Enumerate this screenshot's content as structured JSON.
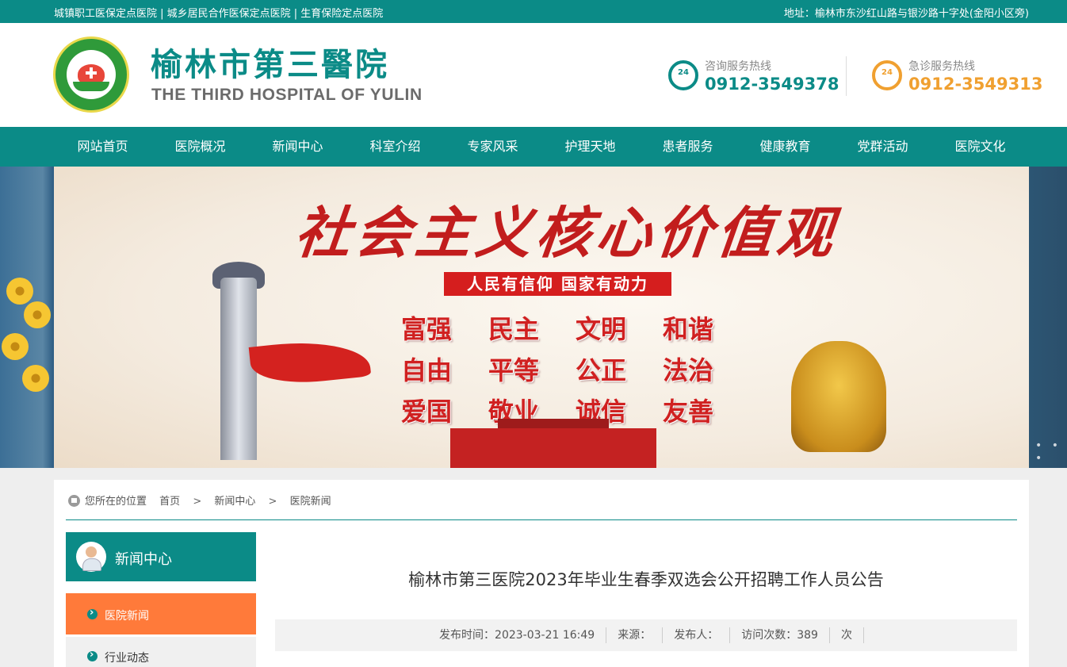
{
  "topbar": {
    "left": "城镇职工医保定点医院 | 城乡居民合作医保定点医院 | 生育保险定点医院",
    "right": "地址：榆林市东沙红山路与银沙路十字处(金阳小区旁)"
  },
  "header": {
    "cn_name": "榆林市第三醫院",
    "en_name": "THE THIRD HOSPITAL OF YULIN",
    "hotline_consult": {
      "label": "咨询服务热线",
      "number": "0912-3549378",
      "badge": "24"
    },
    "hotline_emergency": {
      "label": "急诊服务热线",
      "number": "0912-3549313",
      "badge": "24"
    }
  },
  "nav": {
    "items": [
      "网站首页",
      "医院概况",
      "新闻中心",
      "科室介绍",
      "专家风采",
      "护理天地",
      "患者服务",
      "健康教育",
      "党群活动",
      "医院文化"
    ]
  },
  "banner": {
    "title": "社会主义核心价值观",
    "slogan": "人民有信仰  国家有动力",
    "values": [
      "富强",
      "民主",
      "文明",
      "和谐",
      "自由",
      "平等",
      "公正",
      "法治",
      "爱国",
      "敬业",
      "诚信",
      "友善"
    ]
  },
  "breadcrumb": {
    "prefix": "您所在的位置",
    "items": [
      "首页",
      "新闻中心",
      "医院新闻"
    ],
    "separator": ">"
  },
  "sidebar": {
    "title": "新闻中心",
    "items": [
      {
        "label": "医院新闻",
        "active": true
      },
      {
        "label": "行业动态",
        "active": false
      }
    ]
  },
  "article": {
    "title": "榆林市第三医院2023年毕业生春季双选会公开招聘工作人员公告",
    "meta": {
      "publish_label": "发布时间：",
      "publish_time": "2023-03-21 16:49",
      "source_label": "来源：",
      "author_label": "发布人：",
      "visits_label": "访问次数：",
      "visits": "389",
      "visits_unit": "次"
    }
  },
  "colors": {
    "primary": "#0b8b87",
    "accent_orange": "#ff7a3a",
    "emergency": "#f0a030",
    "banner_red": "#d51e1e"
  }
}
